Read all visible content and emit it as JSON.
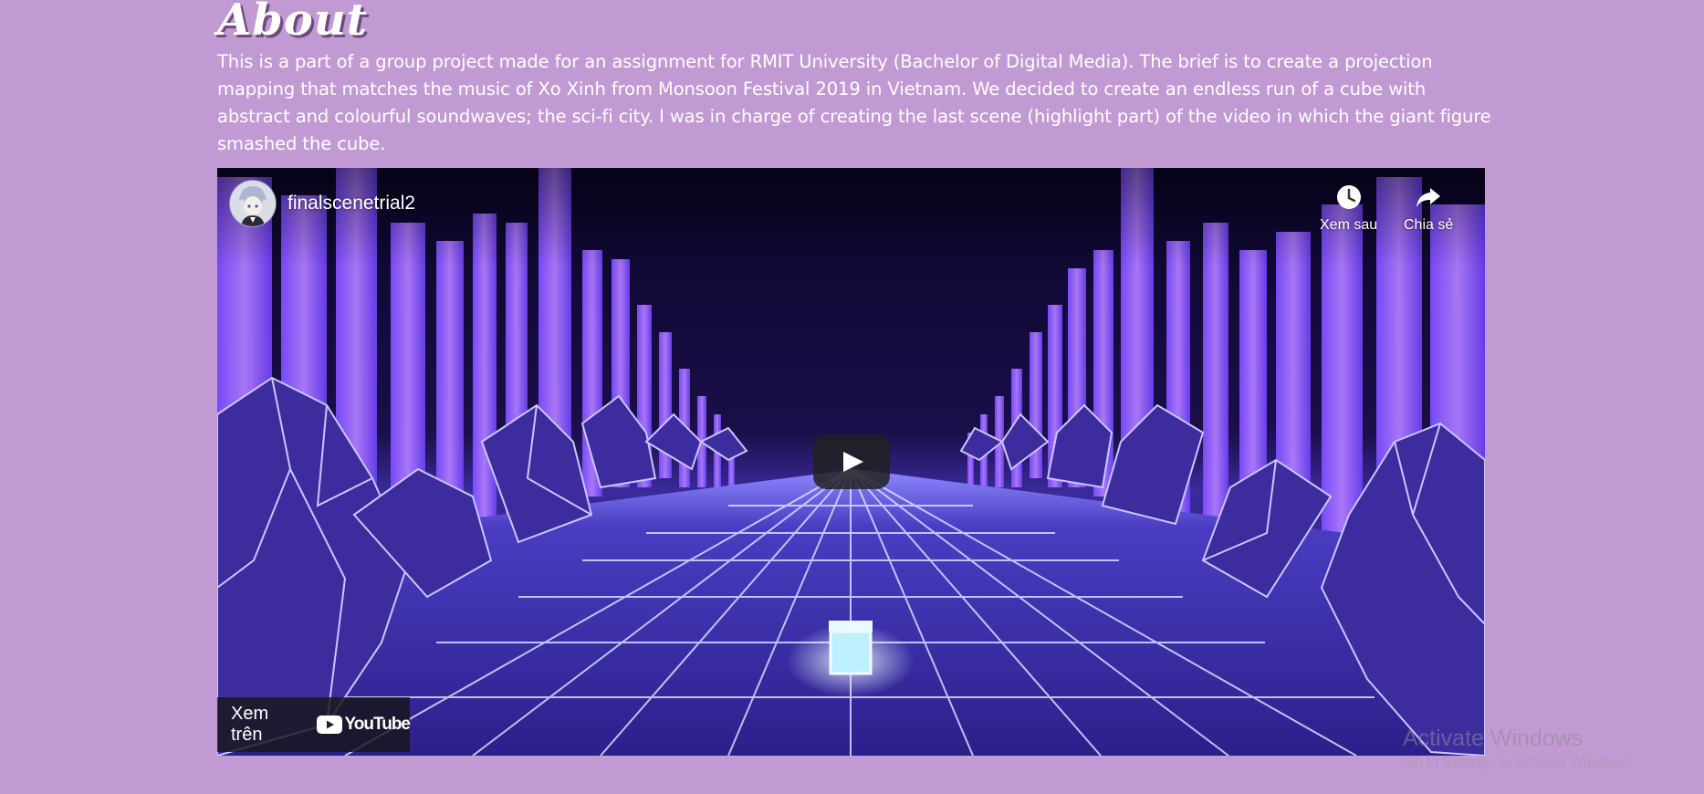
{
  "page": {
    "heading": "About",
    "description": "This is a part of a group project made for an assignment for RMIT University (Bachelor of Digital Media). The brief is to create a projection mapping that matches the music of Xo Xinh from Monsoon Festival 2019 in Vietnam. We decided to create an endless run of a cube with abstract and colourful soundwaves; the sci-fi city. I was in charge of creating the last scene (highlight part) of the video in which the giant figure smashed the cube.",
    "background_color": "#c29ad3"
  },
  "video": {
    "channel_title": "finalscenetrial2",
    "watch_later_label": "Xem sau",
    "share_label": "Chia sẻ",
    "watch_on_label": "Xem trên",
    "youtube_logo_text": "YouTube",
    "icons": {
      "watch_later": "clock-icon",
      "share": "share-arrow-icon",
      "play": "play-icon",
      "youtube": "youtube-logo-icon"
    }
  },
  "os_overlay": {
    "activate_title": "Activate Windows",
    "activate_subtitle": "Go to Settings to activate Windows."
  }
}
